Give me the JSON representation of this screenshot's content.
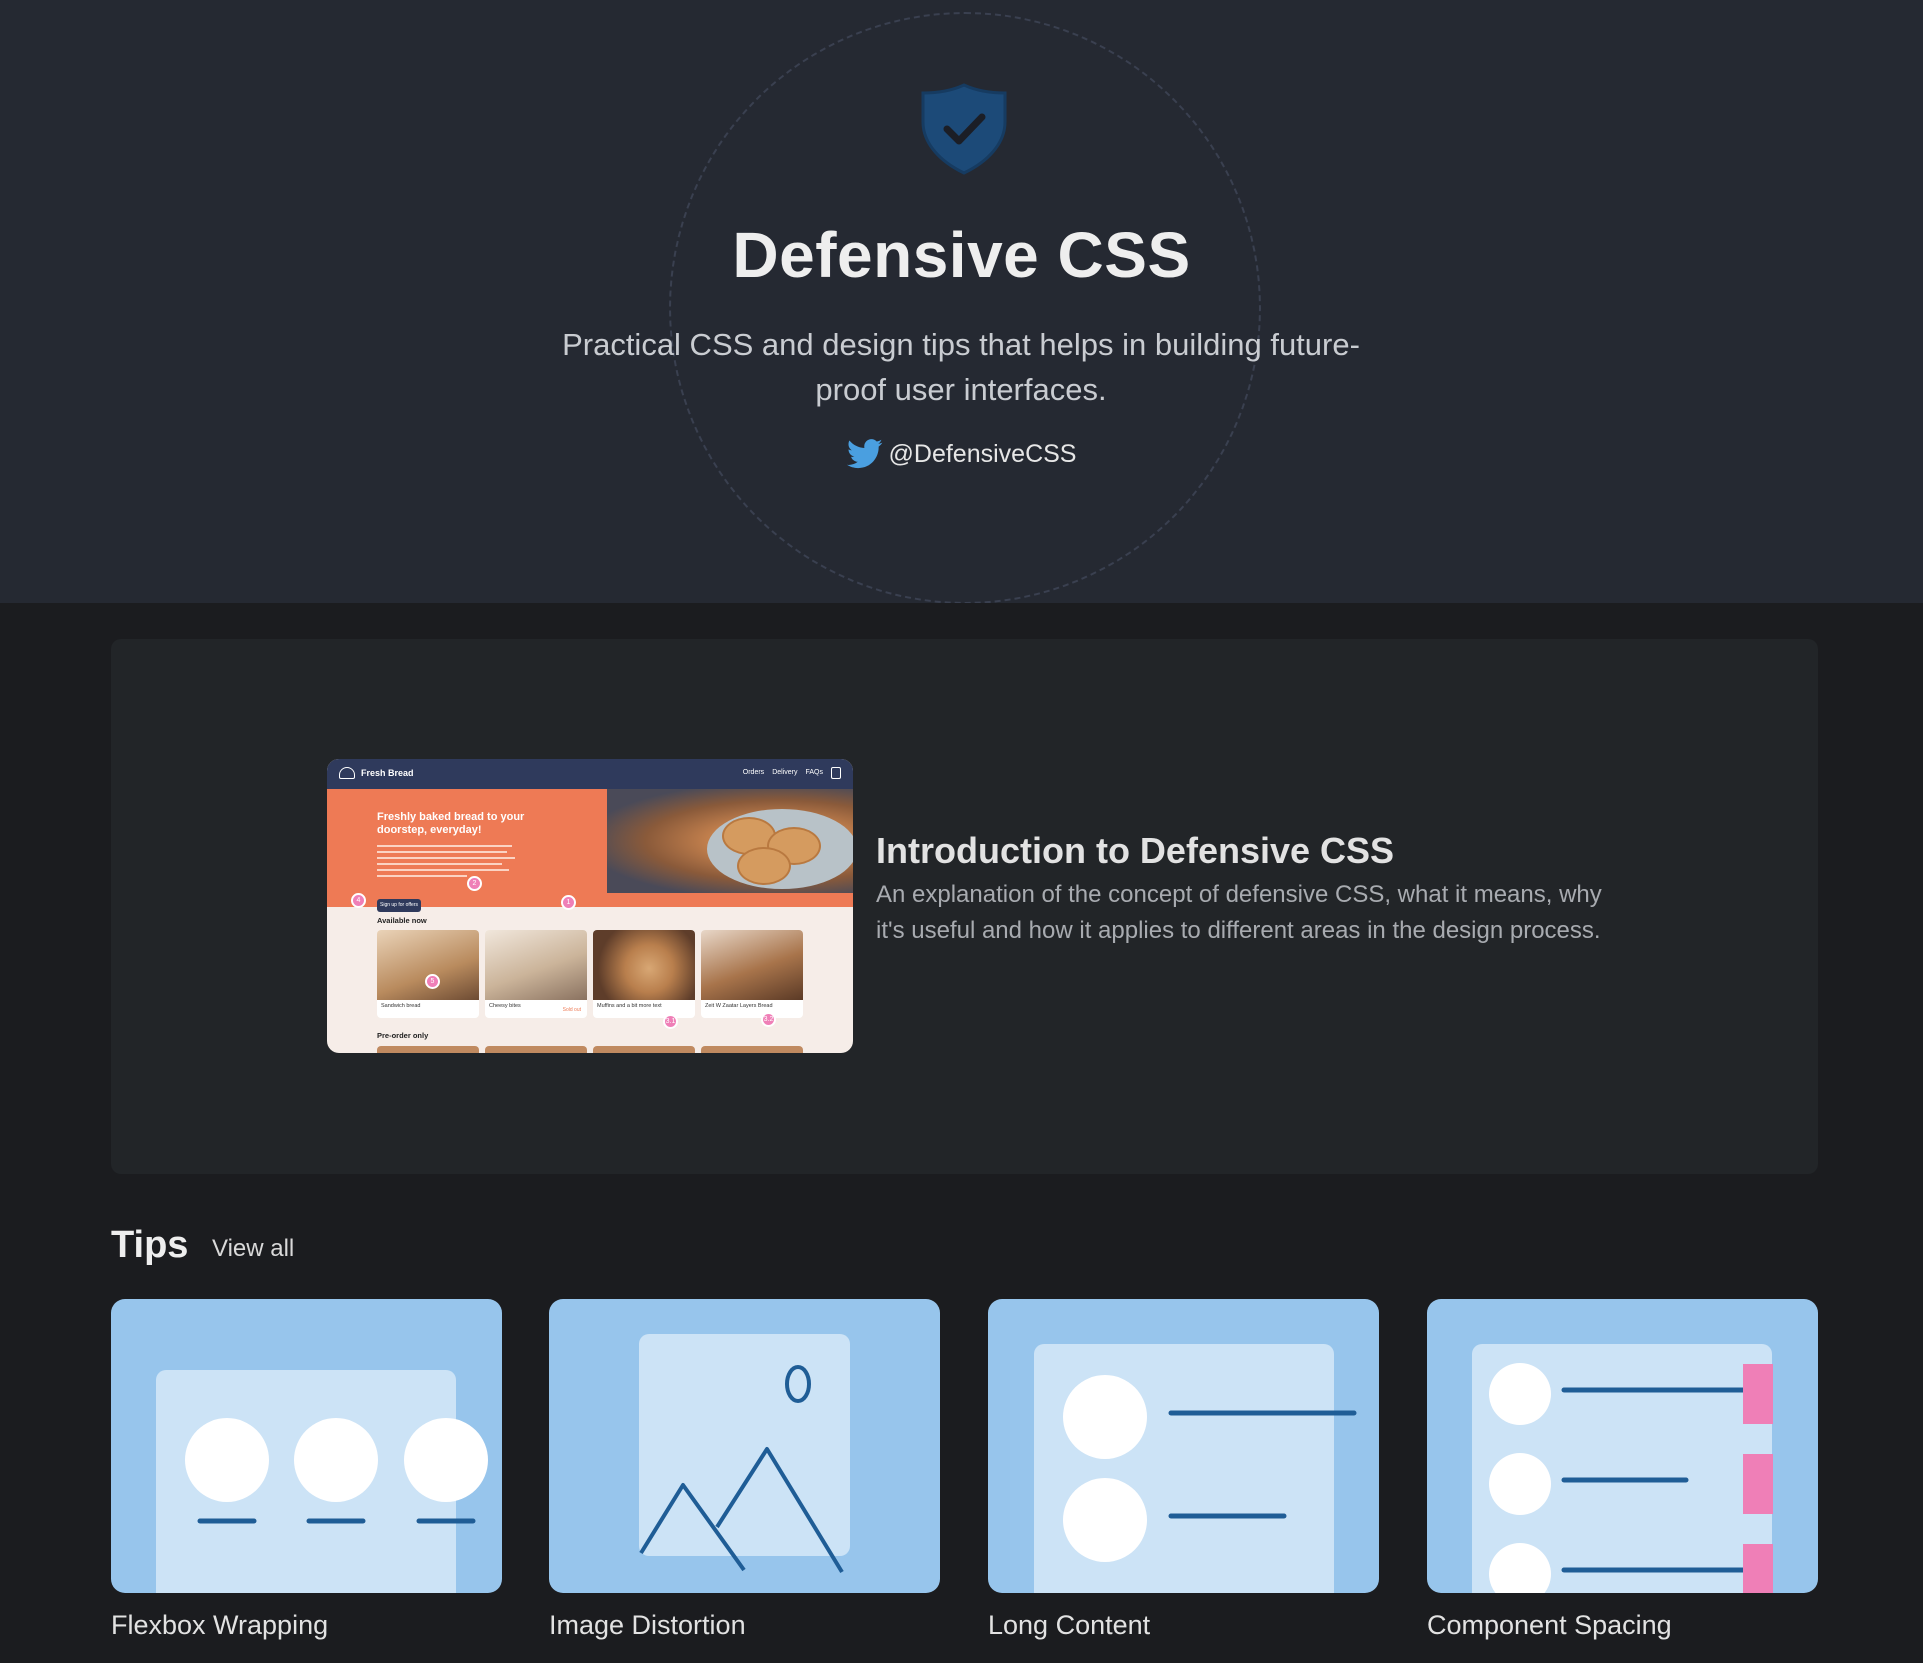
{
  "hero": {
    "title": "Defensive CSS",
    "description": "Practical CSS and design tips that helps in building future-proof user interfaces.",
    "twitter_handle": "@DefensiveCSS",
    "logo_icon": "shield-check-icon",
    "twitter_icon": "twitter-bird-icon"
  },
  "intro": {
    "title": "Introduction to Defensive CSS",
    "description": "An explanation of the concept of defensive CSS, what it means, why it's useful and how it applies to different areas in the design process.",
    "thumbnail": {
      "brand": "Fresh Bread",
      "nav_links": [
        "Orders",
        "Delivery",
        "FAQs"
      ],
      "headline": "Freshly baked bread to your doorstep, everyday!",
      "cta": "Sign up for offers",
      "section_available": "Available now",
      "section_preorder": "Pre-order only",
      "products": [
        {
          "name": "Sandwich bread",
          "status": ""
        },
        {
          "name": "Cheesy bites",
          "status": "Sold out"
        },
        {
          "name": "Muffins and a bit more text",
          "status": ""
        },
        {
          "name": "Zeit W Zaatar Layers Bread",
          "status": ""
        }
      ],
      "markers": [
        "1",
        "2",
        "3.1",
        "3.2",
        "4",
        "5"
      ]
    }
  },
  "tips": {
    "title": "Tips",
    "view_all": "View all",
    "items": [
      {
        "label": "Flexbox Wrapping",
        "icon": "flexbox-wrapping-illustration"
      },
      {
        "label": "Image Distortion",
        "icon": "image-distortion-illustration"
      },
      {
        "label": "Long Content",
        "icon": "long-content-illustration"
      },
      {
        "label": "Component Spacing",
        "icon": "component-spacing-illustration"
      }
    ]
  },
  "colors": {
    "hero_bg": "#252932",
    "page_bg": "#1b1c1f",
    "card_bg": "#222528",
    "tip_bg": "#97c5ec",
    "tip_panel": "#cce3f6",
    "tip_stroke": "#1f5d96",
    "accent_pink": "#ef7fb7",
    "twitter_blue": "#4a9fe0",
    "shield_blue": "#1c4a78"
  }
}
